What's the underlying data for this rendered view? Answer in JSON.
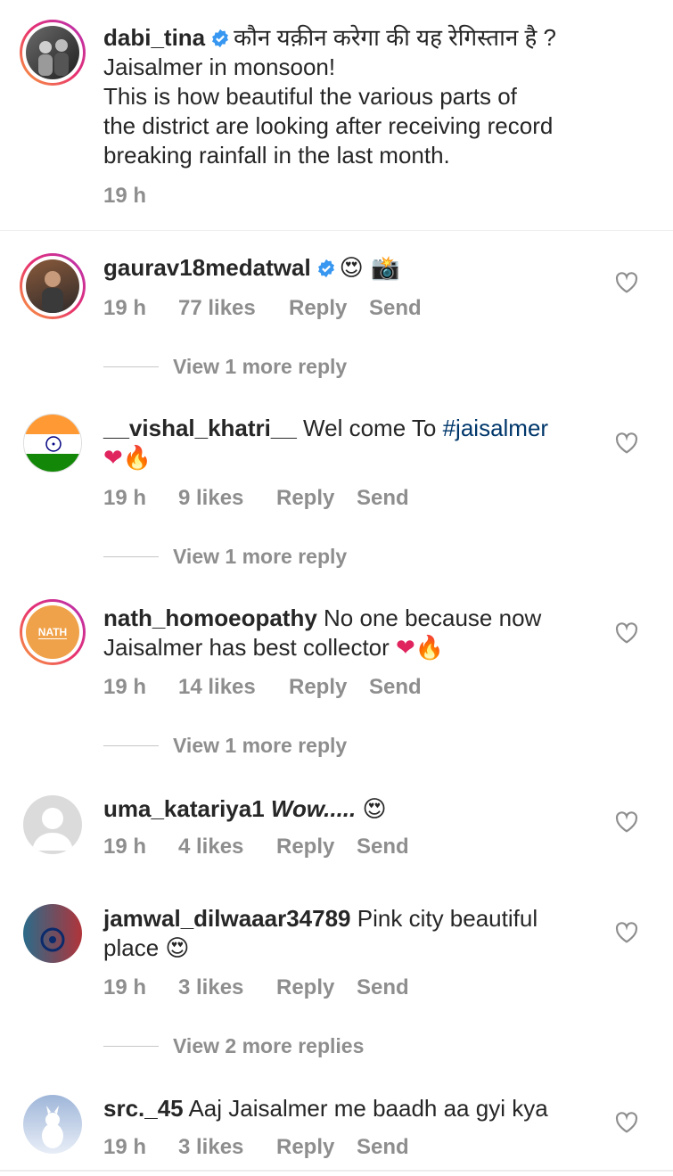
{
  "caption": {
    "username": "dabi_tina",
    "text_line1": "कौन यक़ीन करेगा की यह रेगिस्तान है ?",
    "text_line2": "Jaisalmer in monsoon!",
    "text_line3": "This is how beautiful the various parts of",
    "text_line4": "the district are looking after receiving record",
    "text_line5": "breaking rainfall in the last month.",
    "time": "19 h"
  },
  "labels": {
    "reply": "Reply",
    "send": "Send"
  },
  "comments": [
    {
      "username": "gaurav18medatwal",
      "text": "",
      "emoji": "😍 📸",
      "time": "19 h",
      "likes": "77 likes",
      "view_more": "View 1 more reply"
    },
    {
      "username": "__vishal_khatri__",
      "text": "Wel come To ",
      "hashtag": "#jaisalmer",
      "emoji": "❤🔥",
      "time": "19 h",
      "likes": "9 likes",
      "view_more": "View 1 more reply"
    },
    {
      "username": "nath_homoeopathy",
      "text_line1": "No one because now",
      "text_line2": "Jaisalmer has best collector ",
      "emoji": "❤🔥",
      "time": "19 h",
      "likes": "14 likes",
      "view_more": "View 1 more reply",
      "avatar_text": "NATH"
    },
    {
      "username": "uma_katariya1",
      "text": "Wow.....",
      "emoji": "😍",
      "time": "19 h",
      "likes": "4 likes"
    },
    {
      "username": "jamwal_dilwaaar34789",
      "text_line1": "Pink city beautiful",
      "text_line2": "place ",
      "emoji": "😍",
      "time": "19 h",
      "likes": "3 likes",
      "view_more": "View 2 more replies"
    },
    {
      "username": "src._45",
      "text": "Aaj Jaisalmer me baadh aa gyi kya",
      "time": "19 h",
      "likes": "3 likes"
    }
  ],
  "colors": {
    "hashtag": "#00376b",
    "verified": "#3897f0",
    "meta": "#8e8e8e",
    "heart": "#ed4956"
  }
}
